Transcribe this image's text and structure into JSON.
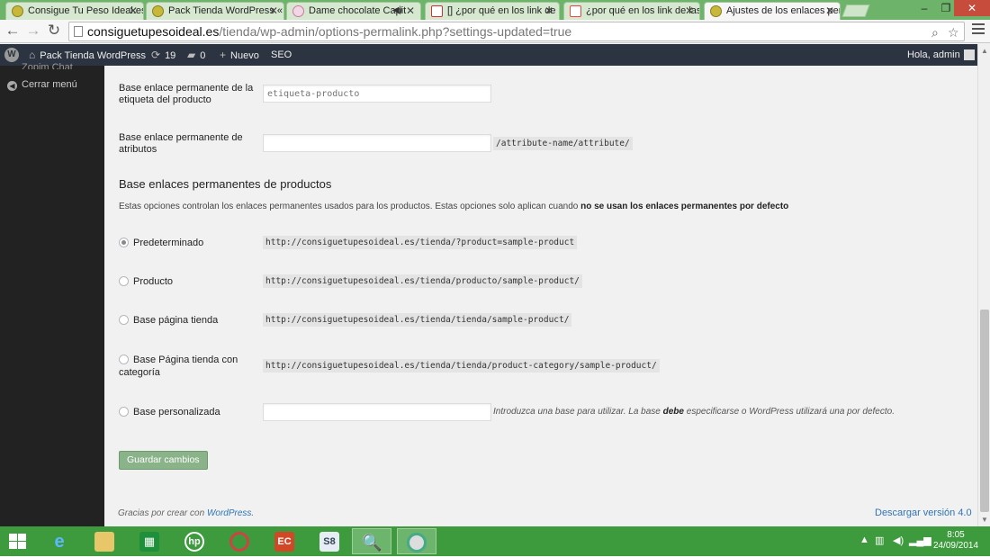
{
  "tabs": [
    {
      "label": "Consigue Tu Peso Ideal.es",
      "icon": "site-favicon"
    },
    {
      "label": "Pack Tienda WordPress «",
      "icon": "site-favicon"
    },
    {
      "label": "Dame chocolate Capit",
      "icon": "chocolate-favicon"
    },
    {
      "label": "[] ¿por qué en los link de l",
      "icon": "gmail-favicon"
    },
    {
      "label": "¿por qué en los link de las",
      "icon": "w-favicon"
    },
    {
      "label": "Ajustes de los enlaces per",
      "icon": "site-favicon",
      "active": true
    }
  ],
  "address": {
    "host": "consiguetupesoideal.es",
    "path": "/tienda/wp-admin/options-permalink.php?settings-updated=true"
  },
  "adminbar": {
    "site_name": "Pack Tienda WordPress",
    "updates_count": "19",
    "comments_count": "0",
    "new_label": "Nuevo",
    "seo_label": "SEO",
    "greeting": "Hola, admin"
  },
  "sidebar": {
    "partial_item": "Zopim Chat",
    "collapse_label": "Cerrar menú"
  },
  "tag_base": {
    "label": "Base enlace permanente de la etiqueta del producto",
    "placeholder": "etiqueta-producto"
  },
  "attribute_base": {
    "label": "Base enlace permanente de atributos",
    "value": "",
    "suffix": "/attribute-name/attribute/"
  },
  "product_permalinks": {
    "heading": "Base enlaces permanentes de productos",
    "description": "Estas opciones controlan los enlaces permanentes usados para los productos. Estas opciones solo aplican cuando",
    "description_bold": "no se usan los enlaces permanentes por defecto",
    "options": [
      {
        "label": "Predeterminado",
        "example": "http://consiguetupesoideal.es/tienda/?product=sample-product",
        "checked": true
      },
      {
        "label": "Producto",
        "example": "http://consiguetupesoideal.es/tienda/producto/sample-product/",
        "checked": false
      },
      {
        "label": "Base página tienda",
        "example": "http://consiguetupesoideal.es/tienda/tienda/sample-product/",
        "checked": false
      },
      {
        "label": "Base Página tienda con categoría",
        "example": "http://consiguetupesoideal.es/tienda/tienda/product-category/sample-product/",
        "checked": false
      },
      {
        "label": "Base personalizada",
        "example": "",
        "checked": false
      }
    ],
    "custom_hint_pre": "Introduzca una base para utilizar. La base",
    "custom_hint_bold": "debe",
    "custom_hint_post": "especificarse o WordPress utilizará una por defecto."
  },
  "save_label": "Guardar cambios",
  "footer": {
    "thanks_pre": "Gracias por crear con",
    "thanks_link": "WordPress",
    "thanks_post": ".",
    "version_link": "Descargar versión 4.0"
  },
  "taskbar": {
    "time": "8:05",
    "date": "24/09/2014"
  },
  "colors": {
    "adminbar_bg": "#2b3440",
    "link": "#2e75b6",
    "save_button": "#8ab38a",
    "taskbar": "#3d9b3d"
  }
}
